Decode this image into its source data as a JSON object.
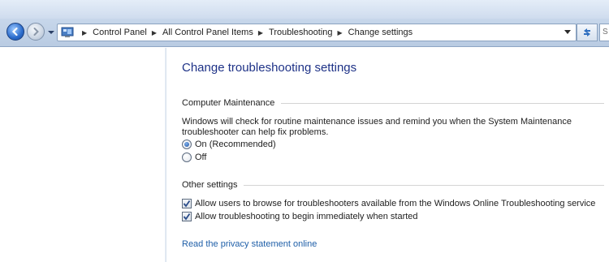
{
  "nav": {
    "back_icon": "back-arrow-icon",
    "forward_icon": "forward-arrow-icon",
    "refresh_icon": "refresh-icon",
    "search_placeholder": "S"
  },
  "breadcrumb": {
    "items": [
      "Control Panel",
      "All Control Panel Items",
      "Troubleshooting",
      "Change settings"
    ]
  },
  "main": {
    "title": "Change troubleshooting settings",
    "maintenance": {
      "heading": "Computer Maintenance",
      "description": "Windows will check for routine maintenance issues and remind you when the System Maintenance troubleshooter can help fix problems.",
      "options": [
        {
          "label": "On (Recommended)",
          "selected": true
        },
        {
          "label": "Off",
          "selected": false
        }
      ]
    },
    "other": {
      "heading": "Other settings",
      "options": [
        {
          "label": "Allow users to browse for troubleshooters available from the Windows Online Troubleshooting service",
          "checked": true
        },
        {
          "label": "Allow troubleshooting to begin immediately when started",
          "checked": true
        }
      ]
    },
    "privacy_link": "Read the privacy statement online"
  },
  "colors": {
    "title": "#1e3287",
    "link": "#1f5fa8"
  }
}
